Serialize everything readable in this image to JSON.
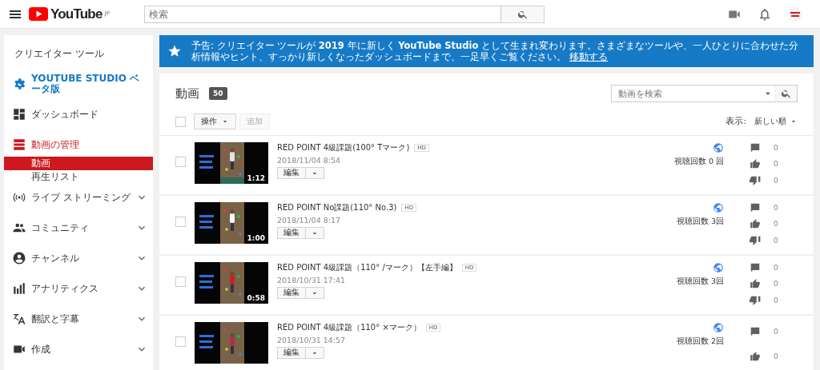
{
  "header": {
    "logo": "YouTube",
    "region": "JP",
    "search": {
      "placeholder": "検索"
    }
  },
  "sidebar": {
    "title": "クリエイター ツール",
    "items": [
      {
        "kind": "studio",
        "label": "YOUTUBE STUDIO ベータ版",
        "selected": false
      },
      {
        "kind": "link",
        "label": "ダッシュボード",
        "selected": false
      },
      {
        "kind": "link",
        "label": "動画の管理",
        "selected": true,
        "children": [
          {
            "label": "動画",
            "selected": true
          },
          {
            "label": "再生リスト",
            "selected": false
          }
        ]
      },
      {
        "kind": "section",
        "label": "ライブ ストリーミング",
        "selected": false
      },
      {
        "kind": "section",
        "label": "コミュニティ",
        "selected": false
      },
      {
        "kind": "section",
        "label": "チャンネル",
        "selected": false
      },
      {
        "kind": "section",
        "label": "アナリティクス",
        "selected": false
      },
      {
        "kind": "section",
        "label": "翻訳と字幕",
        "selected": false
      },
      {
        "kind": "section",
        "label": "作成",
        "selected": false
      }
    ]
  },
  "banner": {
    "text": "予告: クリエイター ツールが **2019** 年に新しく **YouTube Studio** として生まれ変わります。さまざまなツールや、一人ひとりに合わせた分析情報やヒント、すっかり新しくなったダッシュボードまで、一足早くご覧ください。",
    "link": "移動する"
  },
  "videos": {
    "title": "動画",
    "count": "50",
    "select_all": {
      "checked": false
    },
    "search": {
      "placeholder": "動画を検索"
    },
    "actions": "操作",
    "add": "追加",
    "sort_label": "表示:",
    "sort": "新しい順",
    "rows": [
      {
        "checked": false,
        "duration": "1:12",
        "title": "RED POINT 4級課題(100° Tマーク)",
        "quality": "HD",
        "date": "2018/11/04 8:54",
        "edit": "編集",
        "views": "視聴回数 0 回",
        "comments": "0",
        "likes": "0",
        "dislikes": "0"
      },
      {
        "checked": false,
        "duration": "1:00",
        "title": "RED POINT No課題(110° No.3)",
        "quality": "HD",
        "date": "2018/11/04 8:17",
        "edit": "編集",
        "views": "視聴回数 3回",
        "comments": "0",
        "likes": "0",
        "dislikes": "0"
      },
      {
        "checked": false,
        "duration": "0:58",
        "title": "RED POINT 4級課題（110° /マーク）【左手編】",
        "quality": "HD",
        "date": "2018/10/31 17:41",
        "edit": "編集",
        "views": "視聴回数 3回",
        "comments": "0",
        "likes": "0",
        "dislikes": "0"
      },
      {
        "checked": false,
        "title": "RED POINT 4級課題（110° ×マーク）",
        "quality": "HD",
        "date": "2018/10/31 14:57",
        "edit": "編集",
        "views": "視聴回数 2回",
        "comments": "0",
        "likes": "0"
      }
    ]
  }
}
